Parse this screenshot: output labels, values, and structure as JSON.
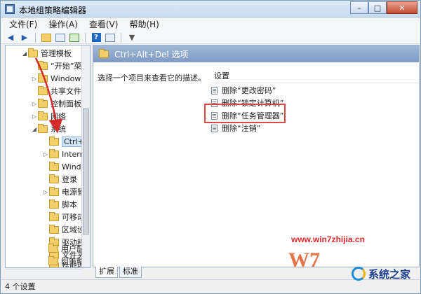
{
  "window": {
    "title": "本地组策略编辑器",
    "caption_minimize": "–",
    "caption_maximize": "□",
    "caption_close": "✕"
  },
  "menu": [
    "文件(F)",
    "操作(A)",
    "查看(V)",
    "帮助(H)"
  ],
  "tree": {
    "items": [
      {
        "label": "管理模板",
        "expander": "◢"
      },
      {
        "label": "“开始”菜",
        "expander": ""
      },
      {
        "label": "Windows",
        "expander": "▷"
      },
      {
        "label": "共享文件夹",
        "expander": ""
      },
      {
        "label": "控制面板",
        "expander": "▷"
      },
      {
        "label": "网络",
        "expander": "▷"
      },
      {
        "label": "系统",
        "expander": "◢"
      },
      {
        "label": "Ctrl+A",
        "expander": ""
      },
      {
        "label": "Intern",
        "expander": "▷"
      },
      {
        "label": "Windo",
        "expander": ""
      },
      {
        "label": "登录",
        "expander": ""
      },
      {
        "label": "电源管",
        "expander": "▷"
      },
      {
        "label": "脚本",
        "expander": ""
      },
      {
        "label": "可移动",
        "expander": ""
      },
      {
        "label": "区域设",
        "expander": ""
      },
      {
        "label": "驱动程",
        "expander": ""
      },
      {
        "label": "文件夹",
        "expander": ""
      },
      {
        "label": "性能控",
        "expander": ""
      },
      {
        "label": "用户配",
        "expander": ""
      },
      {
        "label": "组策略",
        "expander": ""
      }
    ]
  },
  "right": {
    "header": "Ctrl+Alt+Del 选项",
    "description": "选择一个项目来查看它的描述。",
    "column_header": "设置",
    "settings": [
      "删除“更改密码”",
      "删除“锁定计算机”",
      "删除“任务管理器”",
      "删除“注销”"
    ]
  },
  "tabs": [
    "扩展",
    "标准"
  ],
  "status": "4 个设置",
  "watermark": {
    "url": "www.win7zhijia.cn",
    "logo_text": "系统之家",
    "w7": "W7"
  }
}
